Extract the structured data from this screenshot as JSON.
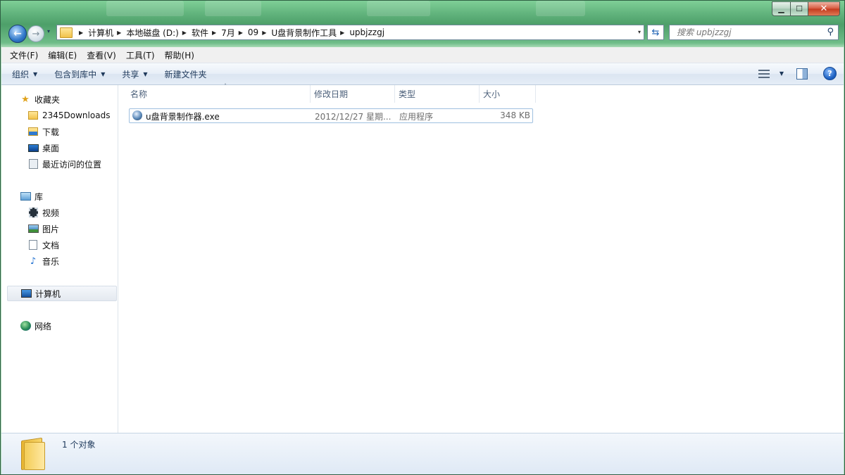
{
  "window": {
    "controls": {
      "minimize": "▁",
      "maximize": "☐",
      "close": "✕"
    }
  },
  "navigation": {
    "back_glyph": "←",
    "forward_glyph": "→",
    "history_glyph": "▾",
    "breadcrumb": [
      "计算机",
      "本地磁盘 (D:)",
      "软件",
      "7月",
      "09",
      "U盘背景制作工具",
      "upbjzzgj"
    ],
    "address_dropdown": "▾",
    "refresh_glyph": "⇆",
    "search_placeholder": "搜索 upbjzzgj",
    "search_glyph": "⚲"
  },
  "menubar": [
    "文件(F)",
    "编辑(E)",
    "查看(V)",
    "工具(T)",
    "帮助(H)"
  ],
  "commandbar": {
    "organize": "组织",
    "include_in_library": "包含到库中",
    "share": "共享",
    "new_folder": "新建文件夹",
    "arrow": "▼",
    "help_glyph": "?"
  },
  "sidebar": {
    "favorites": {
      "label": "收藏夹",
      "icon": "star-icon"
    },
    "favorite_items": [
      {
        "label": "2345Downloads",
        "icon": "folder-icon"
      },
      {
        "label": "下载",
        "icon": "downloads-folder-icon"
      },
      {
        "label": "桌面",
        "icon": "desktop-icon"
      },
      {
        "label": "最近访问的位置",
        "icon": "recent-places-icon"
      }
    ],
    "libraries": {
      "label": "库",
      "icon": "library-icon"
    },
    "library_items": [
      {
        "label": "视频",
        "icon": "video-icon"
      },
      {
        "label": "图片",
        "icon": "pictures-icon"
      },
      {
        "label": "文档",
        "icon": "documents-icon"
      },
      {
        "label": "音乐",
        "icon": "music-icon"
      }
    ],
    "computer": {
      "label": "计算机",
      "icon": "computer-icon"
    },
    "network": {
      "label": "网络",
      "icon": "network-icon"
    }
  },
  "file_list": {
    "columns": [
      "名称",
      "修改日期",
      "类型",
      "大小"
    ],
    "sort_caret": "˄",
    "rows": [
      {
        "name": "u盘背景制作器.exe",
        "date": "2012/12/27 星期...",
        "type": "应用程序",
        "size": "348 KB",
        "icon": "exe-globe-icon"
      }
    ]
  },
  "details_pane": {
    "status": "1 个对象",
    "icon": "folder-large-icon"
  },
  "colors": {
    "title_glass": "#62b47d",
    "command_bar_text": "#1e395b",
    "column_header_text": "#4c607a",
    "secondary_text": "#6d6d6d"
  }
}
